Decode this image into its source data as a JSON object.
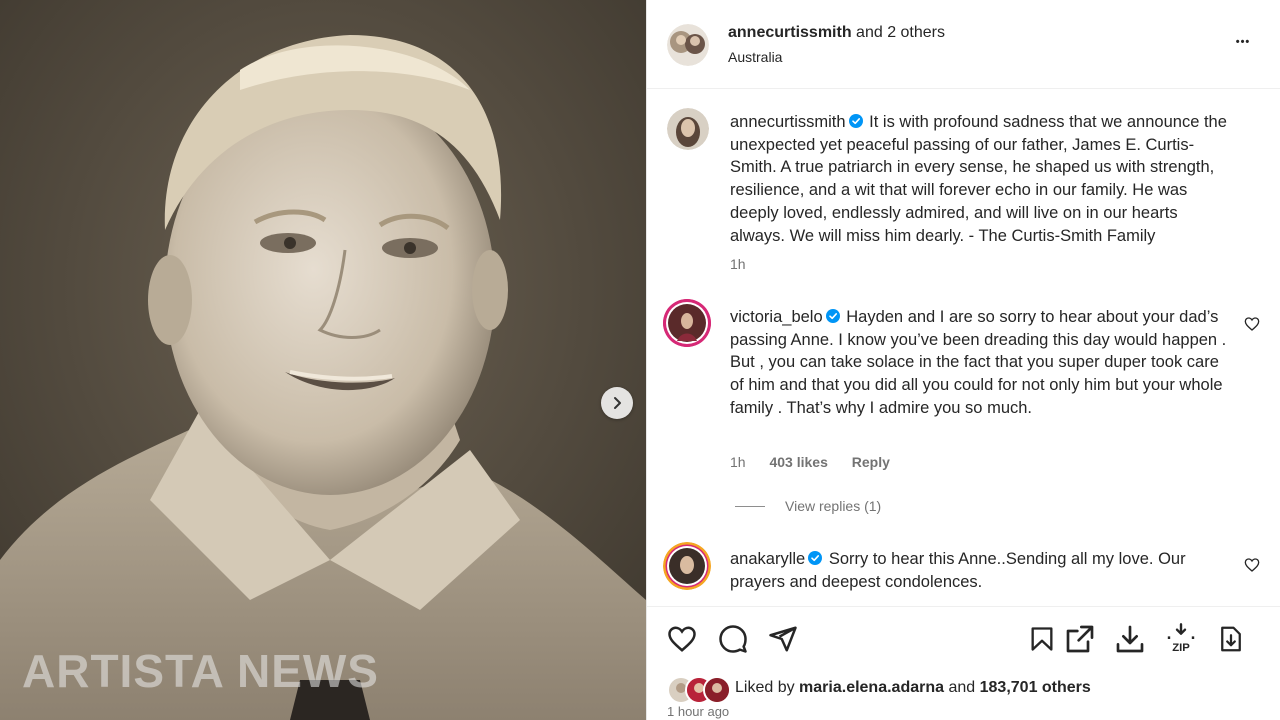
{
  "photo": {
    "watermark": "ARTISTA NEWS"
  },
  "header": {
    "username": "annecurtissmith",
    "coauthors": "and 2 others",
    "location": "Australia",
    "more": "•••"
  },
  "caption": {
    "username": "annecurtissmith",
    "text": "It is with profound sadness that we announce the unexpected yet peaceful passing of our father, James E. Curtis-Smith. A true patriarch in every sense, he shaped us with strength, resilience, and a wit that will forever echo in our family. He was deeply loved, endlessly admired, and will live on in our hearts always. We will miss him dearly. - The Curtis-Smith Family",
    "time": "1h"
  },
  "comments": [
    {
      "username": "victoria_belo",
      "text": "Hayden and I are so sorry to hear about your dad’s passing Anne. I know you’ve been dreading this day would happen . But , you can take solace in the fact that you super duper took care of him and that you did all you could for not only him but your whole family . That’s why I admire you so much.",
      "time": "1h",
      "likes": "403 likes",
      "reply": "Reply",
      "view_replies": "View replies (1)"
    },
    {
      "username": "anakarylle",
      "text": "Sorry to hear this Anne..Sending all my love. Our prayers and deepest condolences."
    }
  ],
  "likes": {
    "prefix": "Liked by",
    "user": "maria.elena.adarna",
    "middle": "and",
    "count": "183,701 others"
  },
  "timestamp": "1 hour ago",
  "colors": {
    "verified": "#0095f6",
    "story_ring": "#d62976"
  }
}
